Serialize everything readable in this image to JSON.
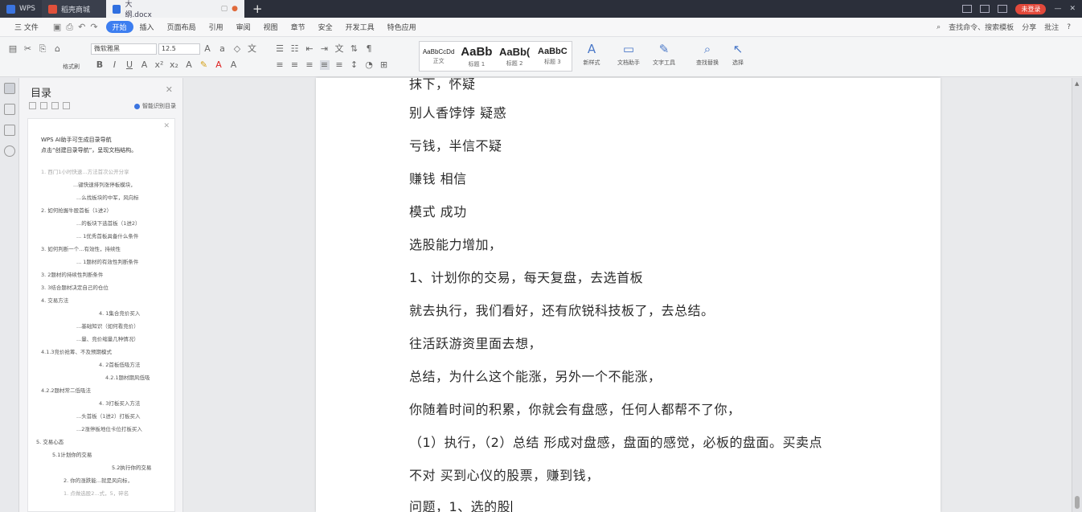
{
  "titlebar": {
    "tabs": [
      {
        "label": "WPS"
      },
      {
        "label": "稻壳商城"
      },
      {
        "label": "大纲.docx"
      }
    ],
    "login_button": "未登录",
    "new_tab": "+"
  },
  "menubar": {
    "file": "三 文件",
    "items": [
      "开始",
      "插入",
      "页面布局",
      "引用",
      "审阅",
      "视图",
      "章节",
      "安全",
      "开发工具",
      "特色应用"
    ],
    "search": "查找命令、搜索模板",
    "share": "分享",
    "comment": "批注"
  },
  "ribbon": {
    "font_name": "微软雅黑",
    "font_size": "12.5",
    "paste": "格式刷",
    "styles": [
      {
        "sample": "AaBbCcDd",
        "label": "正文"
      },
      {
        "sample": "AaBb",
        "label": "标题 1"
      },
      {
        "sample": "AaBb(",
        "label": "标题 2"
      },
      {
        "sample": "AaBbC",
        "label": "标题 3"
      }
    ],
    "new_style": "新样式",
    "doc_helper": "文档助手",
    "text_tool": "文字工具",
    "find_replace": "查找替换",
    "select": "选择"
  },
  "nav": {
    "title": "目录",
    "smart_toc": "智能识别目录",
    "tip_line1": "WPS AI助手可生成目录导航",
    "tip_line2": "点击“创建目录导航”，呈现文档结构。",
    "toc": [
      "1. 西门1小时快速...方法首次公开分享",
      "...键快速排列涨停板模块，",
      "...么找板块的中军，风向标",
      "2. 如何抢握牛股首板（1进2）",
      "...的板块下选首板（1进2）",
      "... 1优秀首板具备什么条件",
      "3. 如何判断一个...有效性，持续性",
      "... 1题材的有效性判断条件",
      "3. 2题材的持续性判断条件",
      "3. 3结合题材决定自己的仓位",
      "4. 交易方法",
      "4. 1集合竞价买入",
      "...基础知识（如何看竞价）",
      "...量、竞价缩量几种情况）",
      "4.1.3竞价抢筹、不及预期模式",
      "4. 2首板低吸方法",
      "4.2.1题材期风低吸",
      "4.2.2题材常二低吸法",
      "4. 3打板买入方法",
      "...头首板（1进2）打板买入",
      "...2涨停板地位卡位打板买入",
      "5. 交易心态",
      "5.1计划你的交易",
      "5.2执行你的交易",
      "2. 你的涨跌能...就是风向标，",
      "1. 点做选股2...式，5，碎名"
    ]
  },
  "document": {
    "lines": [
      "抹下，怀疑",
      "别人香饽饽  疑惑",
      "亏钱，半信不疑",
      "赚钱  相信",
      "模式    成功",
      "选股能力增加，",
      "1、计划你的交易，每天复盘，去选首板",
      "就去执行，我们看好，还有欣锐科技板了，去总结。",
      "往活跃游资里面去想，",
      "总结，为什么这个能涨，另外一个不能涨，",
      "你随着时间的积累，你就会有盘感，任何人都帮不了你，",
      "（1）执行，（2）总结  形成对盘感，盘面的感觉，必板的盘面。买卖点",
      "不对  买到心仪的股票，赚到钱，",
      "问题，1、选的股"
    ]
  }
}
